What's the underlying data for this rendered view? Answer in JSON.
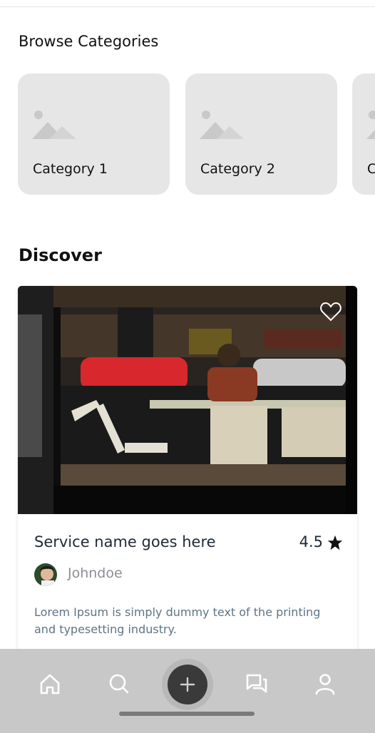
{
  "browse": {
    "title": "Browse Categories",
    "categories": [
      {
        "label": "Category 1"
      },
      {
        "label": "Category 2"
      },
      {
        "label": "C"
      }
    ]
  },
  "discover": {
    "title": "Discover",
    "card": {
      "service_name": "Service name goes here",
      "rating": "4.5",
      "author": "Johndoe",
      "description": "Lorem Ipsum is simply dummy text of the printing and typesetting industry."
    }
  },
  "nav": {
    "items": [
      "home-icon",
      "search-icon",
      "add-icon",
      "chat-icon",
      "profile-icon"
    ]
  },
  "colors": {
    "card_bg": "#e6e6e6",
    "nav_bg": "#c8c8c8",
    "fab": "#3a3a3a"
  }
}
